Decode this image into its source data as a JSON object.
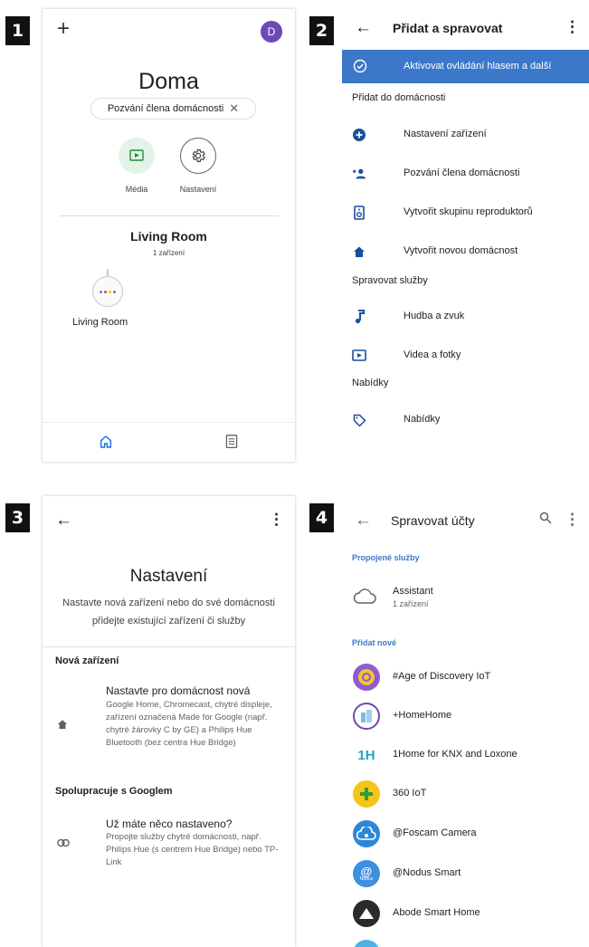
{
  "badges": [
    "1",
    "2",
    "3",
    "4"
  ],
  "screen1": {
    "avatar_initial": "D",
    "home_title": "Doma",
    "invite_chip": "Pozvání člena domácnosti",
    "media_label": "Média",
    "settings_label": "Nastavení",
    "room_title": "Living Room",
    "room_count": "1 zařízení",
    "device_label": "Living Room"
  },
  "screen2": {
    "title": "Přidat a spravovat",
    "highlight": "Aktivovat ovládání hlasem a další",
    "sections": {
      "add": "Přidat do domácnosti",
      "manage": "Spravovat služby",
      "offers": "Nabídky"
    },
    "items": [
      {
        "label": "Nastavení zařízení",
        "icon": "add-circle-icon"
      },
      {
        "label": "Pozvání člena domácnosti",
        "icon": "person-add-icon"
      },
      {
        "label": "Vytvořit skupinu reproduktorů",
        "icon": "speaker-group-icon"
      },
      {
        "label": "Vytvořit novou domácnost",
        "icon": "home-icon"
      },
      {
        "label": "Hudba a zvuk",
        "icon": "music-note-icon"
      },
      {
        "label": "Videa a fotky",
        "icon": "video-icon"
      },
      {
        "label": "Nabídky",
        "icon": "tag-icon"
      }
    ],
    "accent": "#3c78c9"
  },
  "screen3": {
    "title": "Nastavení",
    "subtitle_line1": "Nastavte nová zařízení nebo do své domácnosti",
    "subtitle_line2": "přidejte existující zařízení či služby",
    "section_new": "Nová zařízení",
    "new_head": "Nastavte pro domácnost nová",
    "new_desc": "Google Home, Chromecast, chytré displeje, zařízení označená Made for Google (např. chytré žárovky C by GE) a Philips Hue Bluetooth (bez centra Hue Bridge)",
    "section_works": "Spolupracuje s Googlem",
    "works_head": "Už máte něco nastaveno?",
    "works_desc": "Propojte služby chytré domácnosti, např. Philips Hue (s centrem Hue Bridge) nebo TP-Link"
  },
  "screen4": {
    "title": "Spravovat účty",
    "linked_section": "Propojené služby",
    "linked_name": "Assistant",
    "linked_sub": "1 zařízení",
    "add_section": "Přidat nové",
    "services": [
      {
        "name": "#Age of Discovery IoT",
        "color": "#8e5bd0"
      },
      {
        "name": "+HomeHome",
        "color": "#6a4bb5"
      },
      {
        "name": "1Home for KNX and Loxone",
        "color": "#ffffff"
      },
      {
        "name": "360 IoT",
        "color": "#3bb54a"
      },
      {
        "name": "@Foscam Camera",
        "color": "#2f86d6"
      },
      {
        "name": "@Nodus Smart",
        "color": "#3d8fe0"
      },
      {
        "name": "Abode Smart Home",
        "color": "#2b2b2b"
      }
    ],
    "onehome_logo_text": "1H",
    "nodus_logo_text": "Nodus"
  }
}
